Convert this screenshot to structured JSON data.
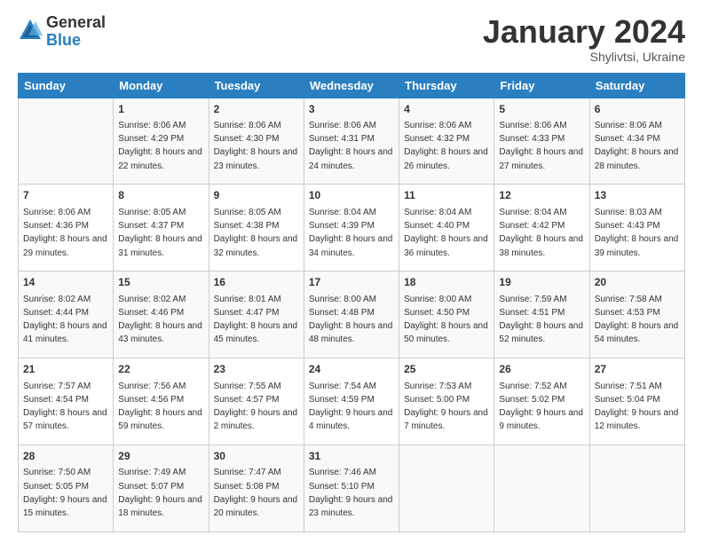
{
  "header": {
    "logo_general": "General",
    "logo_blue": "Blue",
    "month_title": "January 2024",
    "subtitle": "Shylivtsi, Ukraine"
  },
  "weekdays": [
    "Sunday",
    "Monday",
    "Tuesday",
    "Wednesday",
    "Thursday",
    "Friday",
    "Saturday"
  ],
  "weeks": [
    [
      {
        "day": "",
        "sunrise": "",
        "sunset": "",
        "daylight": ""
      },
      {
        "day": "1",
        "sunrise": "Sunrise: 8:06 AM",
        "sunset": "Sunset: 4:29 PM",
        "daylight": "Daylight: 8 hours and 22 minutes."
      },
      {
        "day": "2",
        "sunrise": "Sunrise: 8:06 AM",
        "sunset": "Sunset: 4:30 PM",
        "daylight": "Daylight: 8 hours and 23 minutes."
      },
      {
        "day": "3",
        "sunrise": "Sunrise: 8:06 AM",
        "sunset": "Sunset: 4:31 PM",
        "daylight": "Daylight: 8 hours and 24 minutes."
      },
      {
        "day": "4",
        "sunrise": "Sunrise: 8:06 AM",
        "sunset": "Sunset: 4:32 PM",
        "daylight": "Daylight: 8 hours and 26 minutes."
      },
      {
        "day": "5",
        "sunrise": "Sunrise: 8:06 AM",
        "sunset": "Sunset: 4:33 PM",
        "daylight": "Daylight: 8 hours and 27 minutes."
      },
      {
        "day": "6",
        "sunrise": "Sunrise: 8:06 AM",
        "sunset": "Sunset: 4:34 PM",
        "daylight": "Daylight: 8 hours and 28 minutes."
      }
    ],
    [
      {
        "day": "7",
        "sunrise": "Sunrise: 8:06 AM",
        "sunset": "Sunset: 4:36 PM",
        "daylight": "Daylight: 8 hours and 29 minutes."
      },
      {
        "day": "8",
        "sunrise": "Sunrise: 8:05 AM",
        "sunset": "Sunset: 4:37 PM",
        "daylight": "Daylight: 8 hours and 31 minutes."
      },
      {
        "day": "9",
        "sunrise": "Sunrise: 8:05 AM",
        "sunset": "Sunset: 4:38 PM",
        "daylight": "Daylight: 8 hours and 32 minutes."
      },
      {
        "day": "10",
        "sunrise": "Sunrise: 8:04 AM",
        "sunset": "Sunset: 4:39 PM",
        "daylight": "Daylight: 8 hours and 34 minutes."
      },
      {
        "day": "11",
        "sunrise": "Sunrise: 8:04 AM",
        "sunset": "Sunset: 4:40 PM",
        "daylight": "Daylight: 8 hours and 36 minutes."
      },
      {
        "day": "12",
        "sunrise": "Sunrise: 8:04 AM",
        "sunset": "Sunset: 4:42 PM",
        "daylight": "Daylight: 8 hours and 38 minutes."
      },
      {
        "day": "13",
        "sunrise": "Sunrise: 8:03 AM",
        "sunset": "Sunset: 4:43 PM",
        "daylight": "Daylight: 8 hours and 39 minutes."
      }
    ],
    [
      {
        "day": "14",
        "sunrise": "Sunrise: 8:02 AM",
        "sunset": "Sunset: 4:44 PM",
        "daylight": "Daylight: 8 hours and 41 minutes."
      },
      {
        "day": "15",
        "sunrise": "Sunrise: 8:02 AM",
        "sunset": "Sunset: 4:46 PM",
        "daylight": "Daylight: 8 hours and 43 minutes."
      },
      {
        "day": "16",
        "sunrise": "Sunrise: 8:01 AM",
        "sunset": "Sunset: 4:47 PM",
        "daylight": "Daylight: 8 hours and 45 minutes."
      },
      {
        "day": "17",
        "sunrise": "Sunrise: 8:00 AM",
        "sunset": "Sunset: 4:48 PM",
        "daylight": "Daylight: 8 hours and 48 minutes."
      },
      {
        "day": "18",
        "sunrise": "Sunrise: 8:00 AM",
        "sunset": "Sunset: 4:50 PM",
        "daylight": "Daylight: 8 hours and 50 minutes."
      },
      {
        "day": "19",
        "sunrise": "Sunrise: 7:59 AM",
        "sunset": "Sunset: 4:51 PM",
        "daylight": "Daylight: 8 hours and 52 minutes."
      },
      {
        "day": "20",
        "sunrise": "Sunrise: 7:58 AM",
        "sunset": "Sunset: 4:53 PM",
        "daylight": "Daylight: 8 hours and 54 minutes."
      }
    ],
    [
      {
        "day": "21",
        "sunrise": "Sunrise: 7:57 AM",
        "sunset": "Sunset: 4:54 PM",
        "daylight": "Daylight: 8 hours and 57 minutes."
      },
      {
        "day": "22",
        "sunrise": "Sunrise: 7:56 AM",
        "sunset": "Sunset: 4:56 PM",
        "daylight": "Daylight: 8 hours and 59 minutes."
      },
      {
        "day": "23",
        "sunrise": "Sunrise: 7:55 AM",
        "sunset": "Sunset: 4:57 PM",
        "daylight": "Daylight: 9 hours and 2 minutes."
      },
      {
        "day": "24",
        "sunrise": "Sunrise: 7:54 AM",
        "sunset": "Sunset: 4:59 PM",
        "daylight": "Daylight: 9 hours and 4 minutes."
      },
      {
        "day": "25",
        "sunrise": "Sunrise: 7:53 AM",
        "sunset": "Sunset: 5:00 PM",
        "daylight": "Daylight: 9 hours and 7 minutes."
      },
      {
        "day": "26",
        "sunrise": "Sunrise: 7:52 AM",
        "sunset": "Sunset: 5:02 PM",
        "daylight": "Daylight: 9 hours and 9 minutes."
      },
      {
        "day": "27",
        "sunrise": "Sunrise: 7:51 AM",
        "sunset": "Sunset: 5:04 PM",
        "daylight": "Daylight: 9 hours and 12 minutes."
      }
    ],
    [
      {
        "day": "28",
        "sunrise": "Sunrise: 7:50 AM",
        "sunset": "Sunset: 5:05 PM",
        "daylight": "Daylight: 9 hours and 15 minutes."
      },
      {
        "day": "29",
        "sunrise": "Sunrise: 7:49 AM",
        "sunset": "Sunset: 5:07 PM",
        "daylight": "Daylight: 9 hours and 18 minutes."
      },
      {
        "day": "30",
        "sunrise": "Sunrise: 7:47 AM",
        "sunset": "Sunset: 5:08 PM",
        "daylight": "Daylight: 9 hours and 20 minutes."
      },
      {
        "day": "31",
        "sunrise": "Sunrise: 7:46 AM",
        "sunset": "Sunset: 5:10 PM",
        "daylight": "Daylight: 9 hours and 23 minutes."
      },
      {
        "day": "",
        "sunrise": "",
        "sunset": "",
        "daylight": ""
      },
      {
        "day": "",
        "sunrise": "",
        "sunset": "",
        "daylight": ""
      },
      {
        "day": "",
        "sunrise": "",
        "sunset": "",
        "daylight": ""
      }
    ]
  ]
}
